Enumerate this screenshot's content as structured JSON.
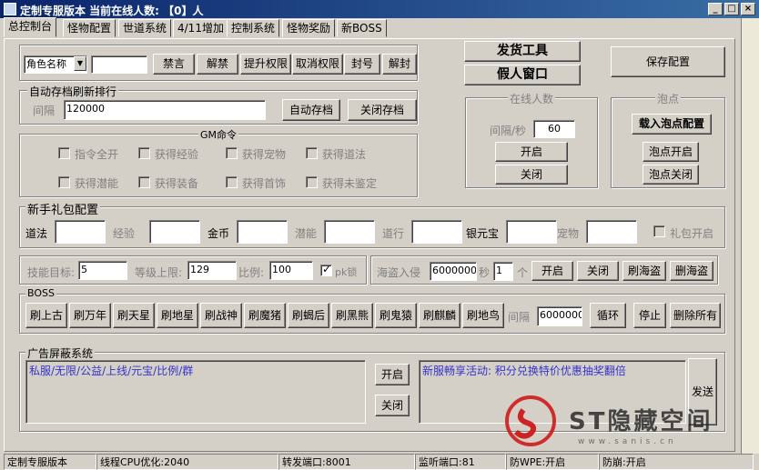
{
  "window": {
    "title": "定制专服版本 当前在线人数: 【0】人"
  },
  "tabs": [
    "总控制台",
    "怪物配置",
    "世道系统",
    "4/11增加",
    "控制系统",
    "怪物奖励",
    "新BOSS"
  ],
  "top_buttons": {
    "ship_tool": "发货工具",
    "fake_window": "假人窗口",
    "save_config": "保存配置"
  },
  "role_bar": {
    "role_select": "角色名称",
    "role_input": "",
    "buttons": [
      "禁言",
      "解禁",
      "提升权限",
      "取消权限",
      "封号",
      "解封"
    ]
  },
  "autosave": {
    "legend": "自动存档刷新排行",
    "interval_label": "间隔",
    "interval_value": "120000",
    "btn_auto": "自动存档",
    "btn_close": "关闭存档"
  },
  "online": {
    "legend": "在线人数",
    "interval_label": "间隔/秒",
    "interval_value": "60",
    "btn_open": "开启",
    "btn_close": "关闭"
  },
  "bubble": {
    "legend": "泡点",
    "btn_load": "载入泡点配置",
    "btn_open": "泡点开启",
    "btn_close": "泡点关闭"
  },
  "gm": {
    "legend": "GM命令",
    "row1": [
      "指令全开",
      "获得经验",
      "获得宠物",
      "获得道法"
    ],
    "row2": [
      "获得潜能",
      "获得装备",
      "获得首饰",
      "获得未鉴定"
    ]
  },
  "newbie": {
    "legend": "新手礼包配置",
    "fields": [
      "道法",
      "经验",
      "金币",
      "潜能",
      "道行",
      "银元宝",
      "宠物"
    ],
    "gift_open": "礼包开启"
  },
  "skill": {
    "target_label": "技能目标:",
    "target_value": "5",
    "level_label": "等级上限:",
    "level_value": "129",
    "ratio_label": "比例:",
    "ratio_value": "100",
    "pk_label": "pk锁"
  },
  "pirate": {
    "label": "海盗入侵",
    "value": "6000000",
    "sec": "秒",
    "count": "1",
    "unit": "个",
    "buttons": [
      "开启",
      "关闭",
      "刷海盗",
      "删海盗"
    ]
  },
  "boss": {
    "legend": "BOSS",
    "buttons": [
      "刷上古",
      "刷万年",
      "刷天星",
      "刷地星",
      "刷战神",
      "刷魔猪",
      "刷蝎后",
      "刷黑熊",
      "刷鬼猿",
      "刷麒麟",
      "刷地鸟"
    ],
    "interval_label": "间隔",
    "interval_value": "6000000",
    "btn_loop": "循环",
    "btn_stop": "停止",
    "btn_delete_all": "删除所有"
  },
  "ads": {
    "legend": "广告屏蔽系统",
    "block_text": "私服/无限/公益/上线/元宝/比例/群",
    "btn_open": "开启",
    "btn_close": "关闭",
    "announce_text": "新服畅享活动: 积分兑换特价优惠抽奖翻倍",
    "btn_send": "发送"
  },
  "statusbar": [
    "定制专服版本",
    "线程CPU优化:2040",
    "转发端口:8001",
    "监听端口:81",
    "防WPE:开启",
    "防崩:开启"
  ],
  "watermark": {
    "text": "ST隐藏空间",
    "url": "www.sanis.cn"
  },
  "colors": {
    "face": "#d4d0c8",
    "title_start": "#0a246a",
    "ad_text": "#3333cc"
  }
}
